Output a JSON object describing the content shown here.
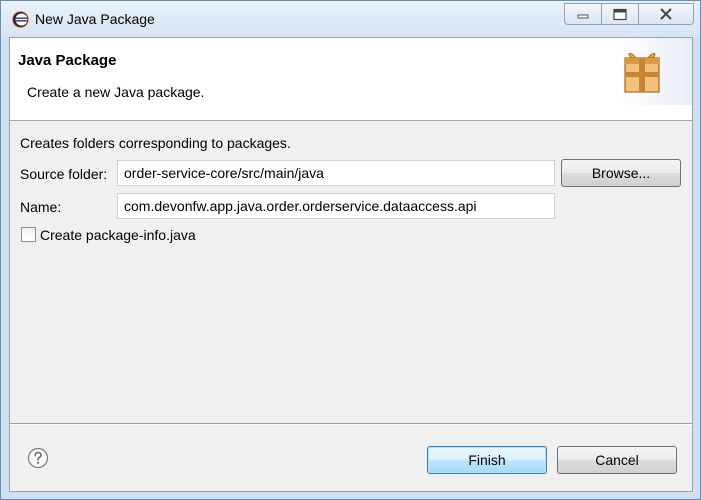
{
  "window": {
    "title": "New Java Package",
    "icon": "eclipse-icon",
    "controls": {
      "minimize_icon": "minimize-icon",
      "maximize_icon": "maximize-icon",
      "close_icon": "close-icon"
    }
  },
  "banner": {
    "title": "Java Package",
    "description": "Create a new Java package.",
    "image_icon": "package-icon"
  },
  "form": {
    "intro": "Creates folders corresponding to packages.",
    "source_folder": {
      "label": "Source folder:",
      "value": "order-service-core/src/main/java"
    },
    "browse_label": "Browse...",
    "name": {
      "label": "Name:",
      "value": "com.devonfw.app.java.order.orderservice.dataaccess.api"
    },
    "package_info": {
      "label": "Create package-info.java",
      "checked": false
    }
  },
  "footer": {
    "help_icon": "help-icon",
    "finish_label": "Finish",
    "cancel_label": "Cancel"
  },
  "colors": {
    "titlebar": "#d6e4f4",
    "dialog_background": "#f0f0f0",
    "banner_background": "#ffffff",
    "default_button": "#bee6fd",
    "eclipse_purple": "#2c2255"
  }
}
